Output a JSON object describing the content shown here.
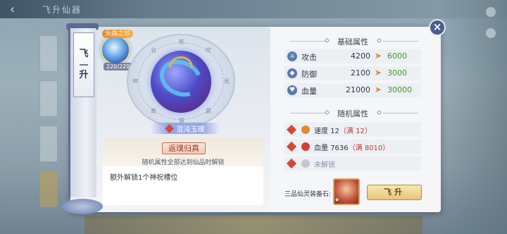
{
  "header": {
    "title": "飞升仙器"
  },
  "tab": {
    "label_top": "飞",
    "label_bottom": "升"
  },
  "treasure": {
    "badge": "头曲之珍",
    "count": "220/220",
    "name": "混沌玉璞",
    "wheel_glyphs": [
      "乾",
      "坎",
      "艮",
      "震",
      "巽",
      "离",
      "坤",
      "兑"
    ]
  },
  "special": {
    "title": "返璞归真",
    "subtitle": "随机属性全部达到仙品时解锁",
    "text": "额外解锁1个神祝槽位"
  },
  "basic": {
    "title": "基础属性",
    "rows": [
      {
        "name": "攻击",
        "current": "4200",
        "next": "6000",
        "icon": "sword-icon",
        "glyph": "⚔"
      },
      {
        "name": "防御",
        "current": "2100",
        "next": "3000",
        "icon": "shield-icon",
        "glyph": "◆"
      },
      {
        "name": "血量",
        "current": "21000",
        "next": "30000",
        "icon": "heart-icon",
        "glyph": "♥"
      }
    ]
  },
  "random": {
    "title": "随机属性",
    "rows": [
      {
        "name": "速度",
        "value": "12",
        "max": "（满 12）"
      },
      {
        "name": "血量",
        "value": "7636",
        "max": "（满 8010）"
      },
      {
        "name": "未解锁"
      }
    ]
  },
  "equip": {
    "label": "三品仙灵装备石:",
    "star": "★"
  },
  "actions": {
    "feisheng": "飞升",
    "close": "×"
  },
  "colors": {
    "accent_gold": "#e7c576",
    "upgrade_green": "#3c9a2c",
    "max_red": "#c0392b",
    "close_blue": "#4d5d8c"
  }
}
